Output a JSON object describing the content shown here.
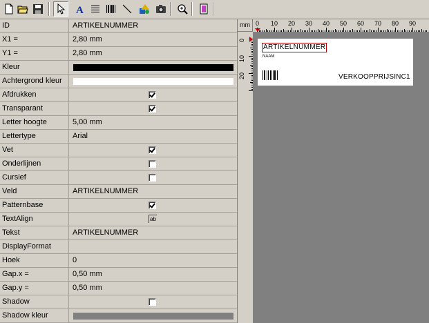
{
  "toolbar": {
    "buttons": [
      {
        "name": "new-file-icon"
      },
      {
        "name": "open-folder-icon"
      },
      {
        "name": "save-icon"
      },
      {
        "name": "select-pointer-icon",
        "pressed": true
      },
      {
        "name": "text-tool-icon",
        "glyph": "A"
      },
      {
        "name": "lines-tool-icon"
      },
      {
        "name": "barcode-tool-icon"
      },
      {
        "name": "line-tool-icon"
      },
      {
        "name": "shapes-tool-icon"
      },
      {
        "name": "image-tool-icon"
      },
      {
        "name": "zoom-icon"
      },
      {
        "name": "page-setup-icon"
      }
    ]
  },
  "properties": [
    {
      "label": "ID",
      "type": "text",
      "value": "ARTIKELNUMMER"
    },
    {
      "label": "X1 =",
      "type": "text",
      "value": "2,80 mm"
    },
    {
      "label": "Y1 =",
      "type": "text",
      "value": "2,80 mm"
    },
    {
      "label": "Kleur",
      "type": "color",
      "color": "#000000"
    },
    {
      "label": "Achtergrond kleur",
      "type": "color",
      "color": "#ffffff"
    },
    {
      "label": "Afdrukken",
      "type": "check",
      "checked": true
    },
    {
      "label": "Transparant",
      "type": "check",
      "checked": true
    },
    {
      "label": "Letter hoogte",
      "type": "text",
      "value": "5,00 mm"
    },
    {
      "label": "Lettertype",
      "type": "text",
      "value": "Arial"
    },
    {
      "label": "Vet",
      "type": "check",
      "checked": true
    },
    {
      "label": "Onderlijnen",
      "type": "check",
      "checked": false
    },
    {
      "label": "Cursief",
      "type": "check",
      "checked": false
    },
    {
      "label": "Veld",
      "type": "text",
      "value": "ARTIKELNUMMER"
    },
    {
      "label": "Patternbase",
      "type": "check",
      "checked": true
    },
    {
      "label": "TextAlign",
      "type": "align",
      "glyph": "ab"
    },
    {
      "label": "Tekst",
      "type": "text",
      "value": "ARTIKELNUMMER"
    },
    {
      "label": "DisplayFormat",
      "type": "text",
      "value": ""
    },
    {
      "label": "Hoek",
      "type": "text",
      "value": "0"
    },
    {
      "label": "Gap.x =",
      "type": "text",
      "value": "0,50 mm"
    },
    {
      "label": "Gap.y =",
      "type": "text",
      "value": "0,50 mm"
    },
    {
      "label": "Shadow",
      "type": "check",
      "checked": false
    },
    {
      "label": "Shadow kleur",
      "type": "color",
      "color": "#808080"
    }
  ],
  "designer": {
    "ruler_unit": "mm",
    "h_ruler_labels": [
      "0",
      "10",
      "20",
      "30",
      "40",
      "50",
      "60",
      "70",
      "80",
      "90"
    ],
    "v_ruler_labels": [
      "0",
      "10",
      "20"
    ],
    "label_texts": {
      "article_number": "ARTIKELNUMMER",
      "name": "NAAM",
      "price": "VERKOOPPRIJSINC1"
    }
  }
}
